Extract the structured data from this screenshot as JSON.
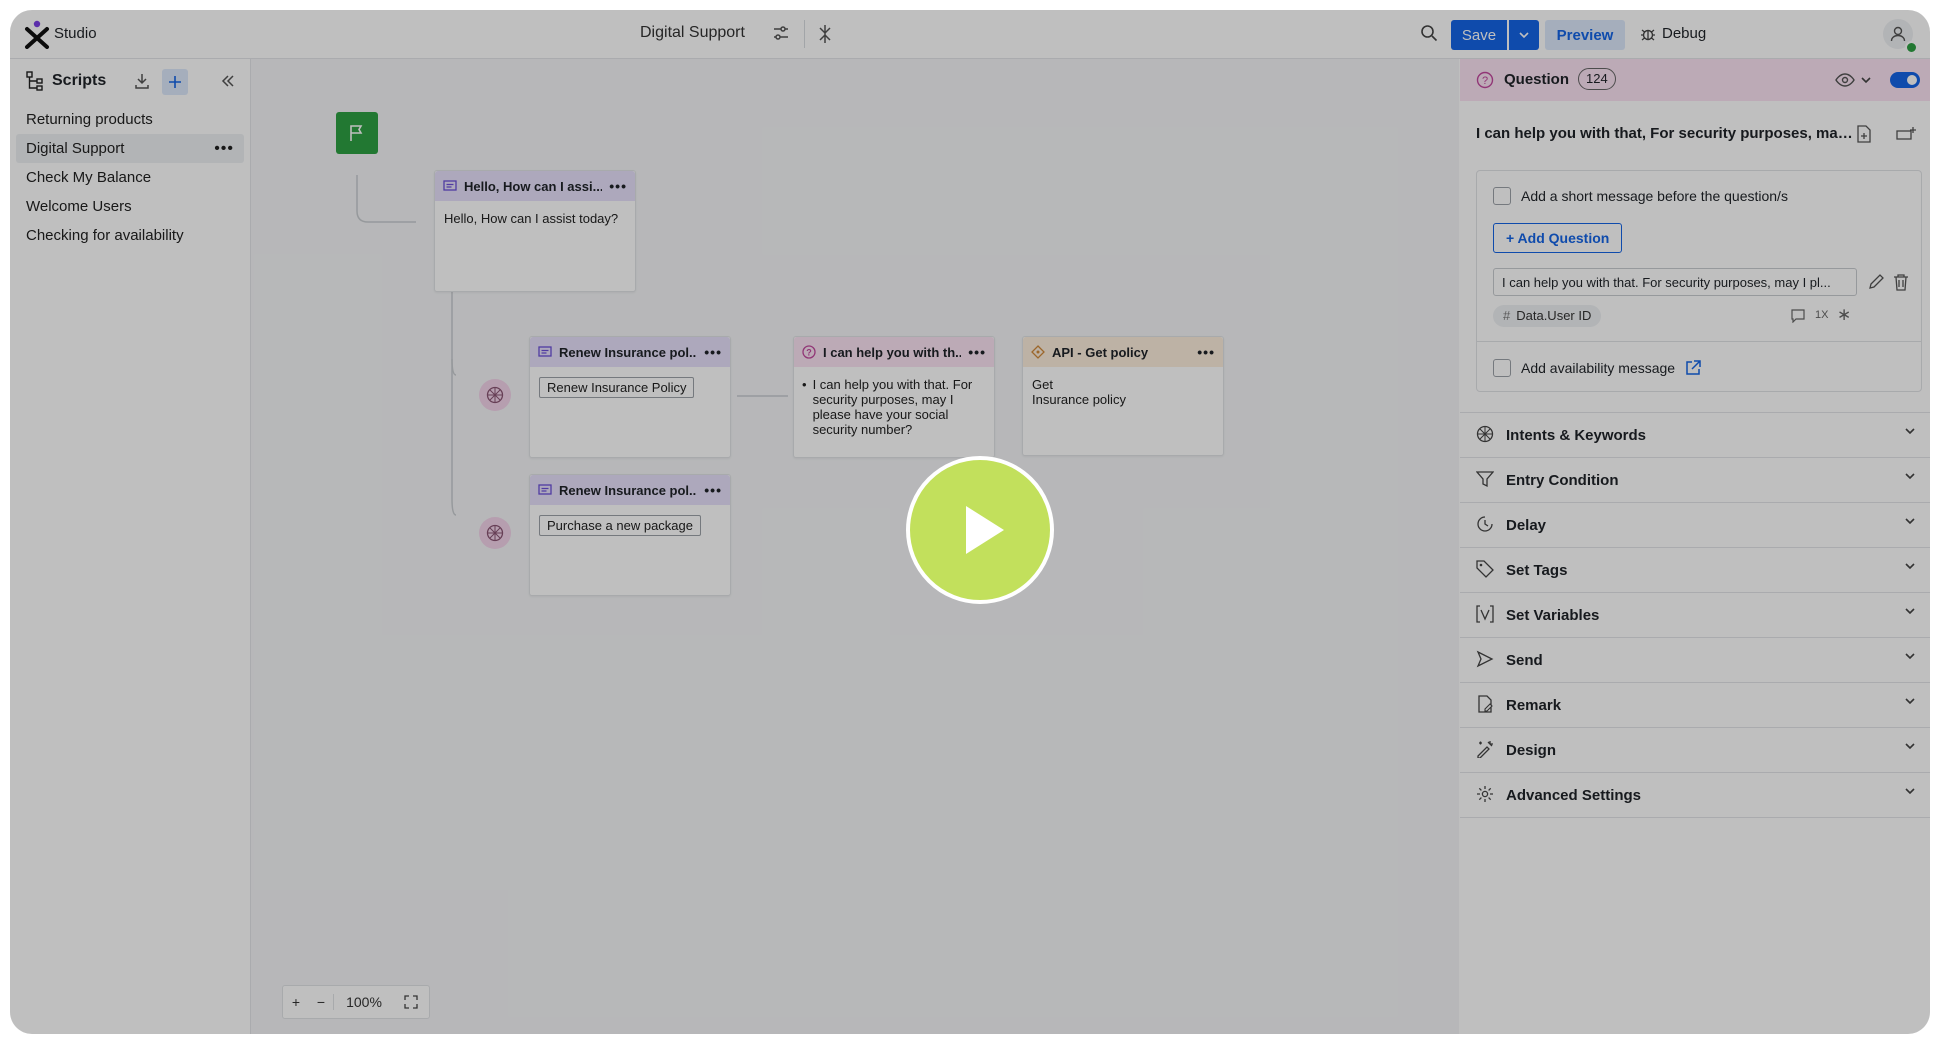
{
  "app": {
    "name": "Studio"
  },
  "header": {
    "script_title": "Digital Support",
    "save_label": "Save",
    "preview_label": "Preview",
    "debug_label": "Debug"
  },
  "sidebar": {
    "title": "Scripts",
    "items": [
      {
        "label": "Returning products"
      },
      {
        "label": "Digital Support",
        "active": true
      },
      {
        "label": "Check My Balance"
      },
      {
        "label": "Welcome Users"
      },
      {
        "label": "Checking for availability"
      }
    ]
  },
  "canvas": {
    "nodes": {
      "greeting": {
        "title": "Hello, How can I assi...",
        "body": "Hello, How can I assist today?"
      },
      "renew1": {
        "title": "Renew Insurance pol...",
        "chip": "Renew Insurance Policy"
      },
      "renew2": {
        "title": "Renew Insurance pol...",
        "chip": "Purchase a new package"
      },
      "question": {
        "title": "I can help you with th...",
        "body": "I can help you with that. For security purposes, may I please have your social security number?"
      },
      "api": {
        "title": "API - Get policy",
        "line1": "Get",
        "line2": "Insurance policy"
      }
    },
    "zoom": "100%"
  },
  "panel": {
    "type_label": "Question",
    "count": "124",
    "subtitle": "I can help you with that, For security purposes, may...",
    "short_message_label": "Add a short message before the question/s",
    "add_question_label": "+ Add Question",
    "question_text": "I can help you with that. For security purposes, may I pl...",
    "variable": "Data.User ID",
    "repeat": "1X",
    "availability_label": "Add availability message",
    "sections": [
      {
        "label": "Intents & Keywords",
        "icon": "brain-icon"
      },
      {
        "label": "Entry Condition",
        "icon": "filter-icon"
      },
      {
        "label": "Delay",
        "icon": "clock-icon"
      },
      {
        "label": "Set Tags",
        "icon": "tag-icon"
      },
      {
        "label": "Set Variables",
        "icon": "variable-icon"
      },
      {
        "label": "Send",
        "icon": "send-icon"
      },
      {
        "label": "Remark",
        "icon": "remark-icon"
      },
      {
        "label": "Design",
        "icon": "design-icon"
      },
      {
        "label": "Advanced Settings",
        "icon": "gear-icon"
      }
    ]
  },
  "colors": {
    "primary": "#1565e6",
    "start_node": "#2ea043",
    "message_header": "#e7e1fb",
    "question_header": "#fbe3f3",
    "api_header": "#fdeedd",
    "play_button": "#c2e05c"
  }
}
